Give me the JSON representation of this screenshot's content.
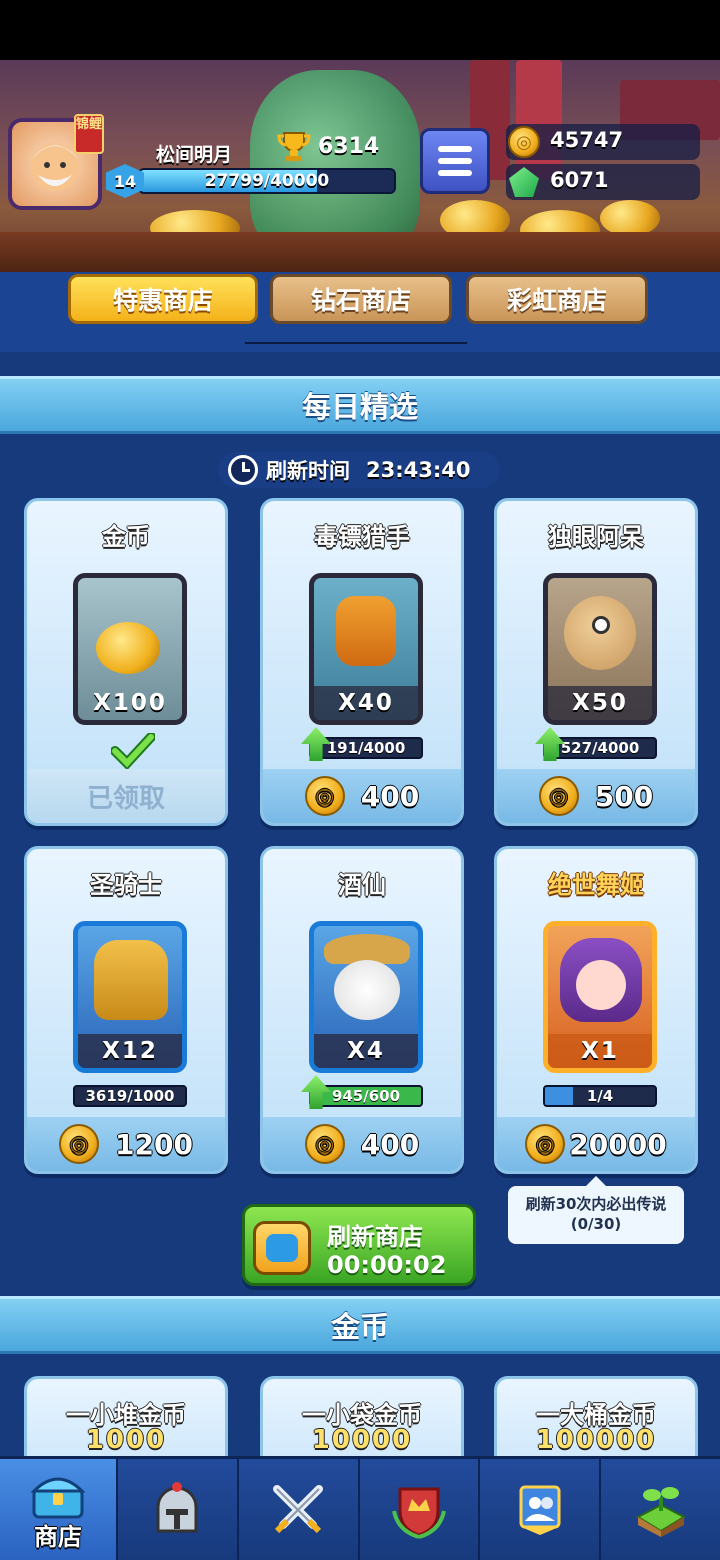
{
  "player": {
    "name": "松间明月",
    "level": "14",
    "trophies": "6314",
    "xp_text": "27799/40000",
    "xp_fraction": 0.695,
    "badge": "锦鲤"
  },
  "currency": {
    "gold": "45747",
    "gems": "6071"
  },
  "tabs": [
    {
      "label": "特惠商店",
      "active": true
    },
    {
      "label": "钻石商店",
      "active": false
    },
    {
      "label": "彩虹商店",
      "active": false
    }
  ],
  "daily": {
    "header": "每日精选",
    "refresh_label": "刷新时间",
    "refresh_time": "23:43:40",
    "items": [
      {
        "name": "金币",
        "qty": "X100",
        "status": "已领取",
        "icon": "gold-coins-icon"
      },
      {
        "name": "毒镖猎手",
        "qty": "X40",
        "progress": "191/4000",
        "progress_fraction": 0.05,
        "price": "400",
        "icon": "dart-hunter-icon"
      },
      {
        "name": "独眼阿呆",
        "qty": "X50",
        "progress": "527/4000",
        "progress_fraction": 0.13,
        "price": "500",
        "icon": "one-eyed-dummy-icon"
      },
      {
        "name": "圣骑士",
        "qty": "X12",
        "progress": "3619/1000",
        "progress_fraction": 1.0,
        "price": "1200",
        "icon": "paladin-icon"
      },
      {
        "name": "酒仙",
        "qty": "X4",
        "progress": "945/600",
        "progress_fraction": 1.0,
        "price": "400",
        "icon": "wine-immortal-icon"
      },
      {
        "name": "绝世舞姬",
        "qty": "X1",
        "progress": "1/4",
        "progress_fraction": 0.25,
        "price": "20000",
        "icon": "dancer-icon"
      }
    ],
    "tooltip_line1": "刷新30次内必出传说",
    "tooltip_line2": "(0/30)",
    "refresh_button": {
      "label": "刷新商店",
      "timer": "00:00:02"
    }
  },
  "gold_section": {
    "header": "金币",
    "packs": [
      {
        "name": "一小堆金币",
        "amount": "1000"
      },
      {
        "name": "一小袋金币",
        "amount": "10000"
      },
      {
        "name": "一大桶金币",
        "amount": "100000"
      }
    ]
  },
  "nav": [
    {
      "label": "商店",
      "icon": "shop-chest-icon",
      "active": true
    },
    {
      "label": "",
      "icon": "knight-helmet-icon"
    },
    {
      "label": "",
      "icon": "crossed-swords-icon"
    },
    {
      "label": "",
      "icon": "crown-shield-icon"
    },
    {
      "label": "",
      "icon": "guild-banner-icon"
    },
    {
      "label": "",
      "icon": "sprout-island-icon"
    }
  ],
  "colors": {
    "gold": "#f0ad1c",
    "gem": "#1ea84a",
    "accent_blue": "#4ba7dc",
    "nav_active": "#2a62c0"
  }
}
